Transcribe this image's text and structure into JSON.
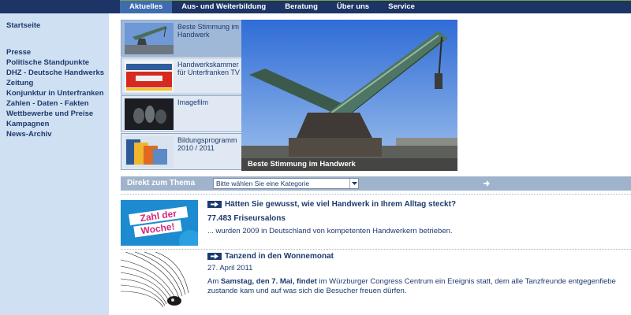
{
  "nav": {
    "tabs": [
      {
        "label": "Aktuelles"
      },
      {
        "label": "Aus- und Weiterbildung"
      },
      {
        "label": "Beratung"
      },
      {
        "label": "Über uns"
      },
      {
        "label": "Service"
      }
    ]
  },
  "sidebar": {
    "start": "Startseite",
    "items": [
      {
        "label": "Presse"
      },
      {
        "label": "Politische Standpunkte"
      },
      {
        "label": "DHZ - Deutsche Handwerks Zeitung"
      },
      {
        "label": "Konjunktur in Unterfranken"
      },
      {
        "label": "Zahlen - Daten - Fakten"
      },
      {
        "label": "Wettbewerbe und Preise"
      },
      {
        "label": "Kampagnen"
      },
      {
        "label": "News-Archiv"
      }
    ]
  },
  "gallery": {
    "items": [
      {
        "label": "Beste Stimmung im Handwerk"
      },
      {
        "label": "Handwerkskammer für Unterfranken TV"
      },
      {
        "label": "Imagefilm"
      },
      {
        "label": "Bildungsprogramm 2010 / 2011"
      }
    ],
    "caption": "Beste Stimmung im Handwerk"
  },
  "thema": {
    "label": "Direkt zum Thema",
    "select_value": "Bitte wählen Sie eine Kategorie"
  },
  "news": [
    {
      "headline": "Hätten Sie gewusst, wie viel Handwerk in Ihrem Alltag steckt?",
      "subhead": "77.483 Friseursalons",
      "text": "... wurden 2009 in Deutschland von kompetenten Handwerkern betrieben.",
      "image_text_1": "Zahl der",
      "image_text_2": "Woche!"
    },
    {
      "headline": "Tanzend in den Wonnemonat",
      "date": "27. April 2011",
      "text_1": "Am ",
      "text_bold_1": "Samstag, den 7. Mai, findet",
      "text_2": " im Würzburger Congress Centrum ein Ereignis statt, dem alle Tanzfreunde entgegenfiebe",
      "text_3": "zustande kam und auf was sich die Besucher freuen dürfen."
    }
  ],
  "colors": {
    "nav_bg": "#1c3466",
    "nav_active": "#3f6cb0",
    "sidebar_bg": "#cfe0f2",
    "link": "#1d3a6e",
    "thema_bar": "#9fb3cc"
  }
}
